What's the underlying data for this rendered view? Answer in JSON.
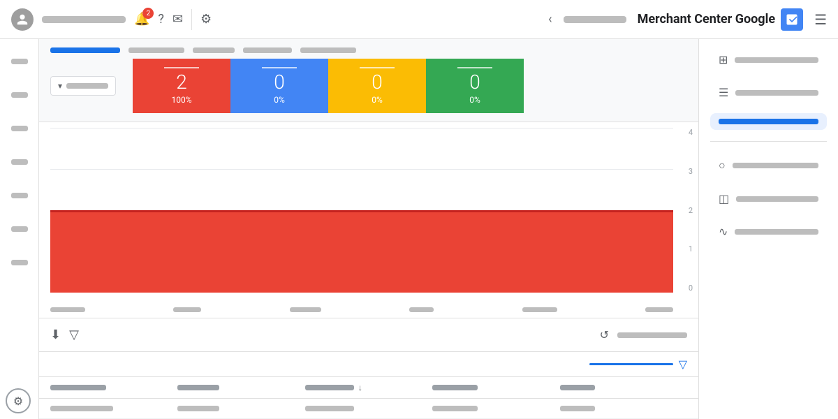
{
  "header": {
    "title": "Merchant Center",
    "title_bold": "Google",
    "back_btn": "‹",
    "notification_count": "2",
    "app_icon": "🏪"
  },
  "status_cards": [
    {
      "color": "red",
      "value": "2",
      "pct": "100%",
      "label": ""
    },
    {
      "color": "blue",
      "value": "0",
      "pct": "0%",
      "label": ""
    },
    {
      "color": "yellow",
      "value": "0",
      "pct": "0%",
      "label": ""
    },
    {
      "color": "green",
      "value": "0",
      "pct": "0%",
      "label": ""
    }
  ],
  "chart": {
    "y_labels": [
      "4",
      "3",
      "2",
      "1",
      "0"
    ],
    "bar_height_pct": 50
  },
  "right_sidebar": {
    "items": [
      {
        "icon": "⊞",
        "active": false
      },
      {
        "icon": "☰",
        "active": false
      },
      {
        "icon": "",
        "active": true,
        "text_width": 80
      },
      {
        "icon": "○",
        "active": false
      },
      {
        "icon": "◫",
        "active": false
      },
      {
        "icon": "∿",
        "active": false
      }
    ]
  },
  "bottom_toolbar": {
    "download_icon": "⬇",
    "filter_icon": "▽",
    "refresh_icon": "↺"
  },
  "table": {
    "headers": [
      "",
      "",
      "↓",
      "",
      ""
    ],
    "rows": [
      [
        "",
        "",
        "",
        "",
        ""
      ],
      [
        "",
        "",
        "",
        "",
        ""
      ]
    ]
  },
  "gear_icon": "⚙"
}
